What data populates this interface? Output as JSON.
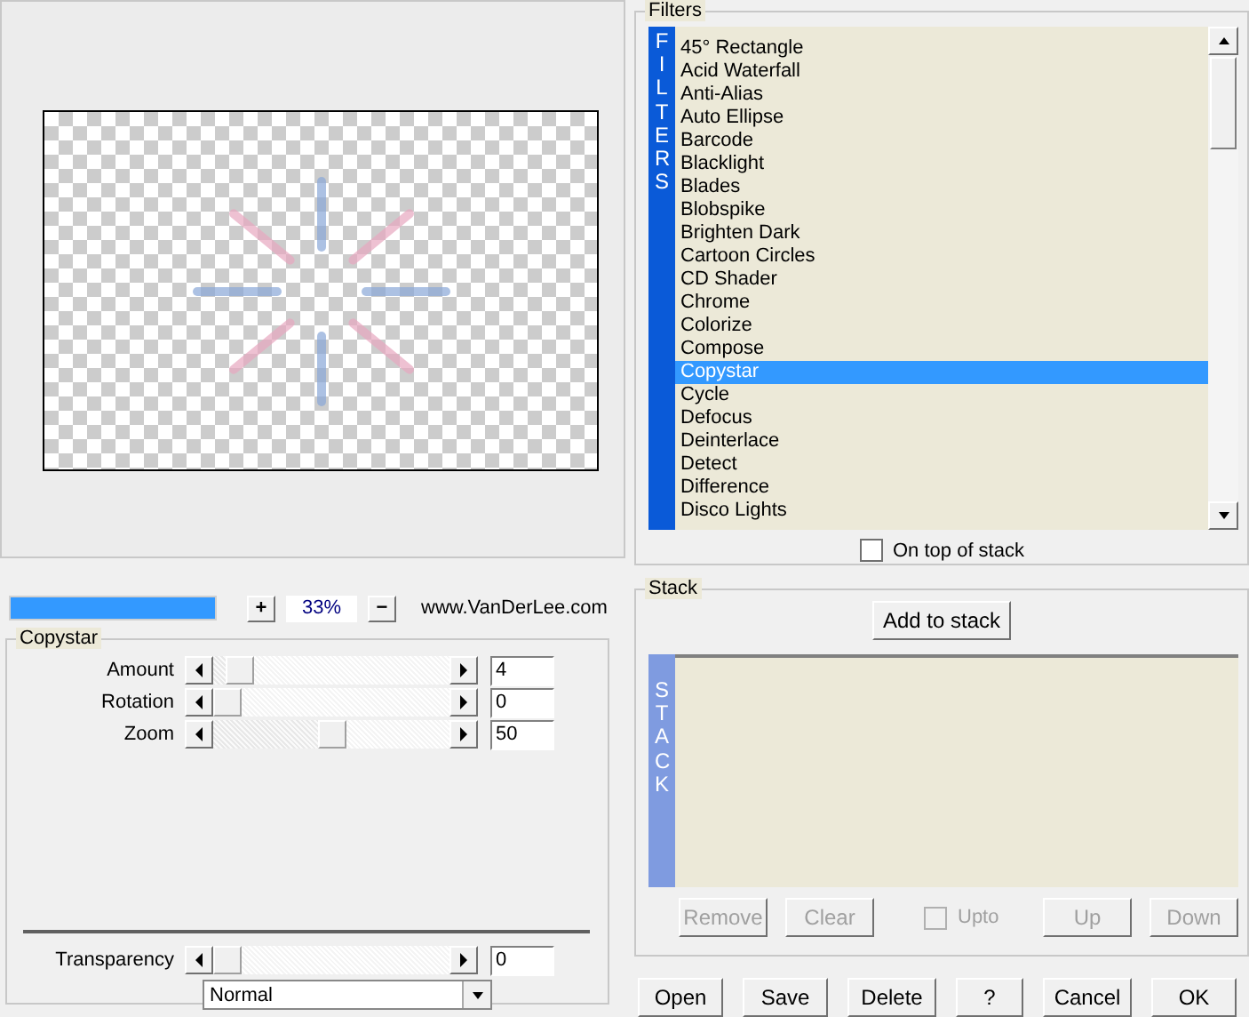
{
  "preview": {
    "zoom_progress": {
      "level": 1
    },
    "zoom_value": "33%",
    "zoom_in": "+",
    "zoom_out": "−",
    "credit": "www.VanDerLee.com"
  },
  "settings": {
    "title": "Copystar",
    "sliders": [
      {
        "label": "Amount",
        "level": 0.06,
        "value": "4"
      },
      {
        "label": "Rotation",
        "level": 0,
        "value": "0"
      },
      {
        "label": "Zoom",
        "level": 0.5,
        "value": "50"
      }
    ],
    "transparency": {
      "label": "Transparency",
      "level": 0,
      "value": "0"
    },
    "blend_mode": "Normal"
  },
  "filters": {
    "title": "Filters",
    "side_label": "FILTERS",
    "items": [
      {
        "label": "45° Rectangle",
        "selected": false
      },
      {
        "label": "Acid Waterfall",
        "selected": false
      },
      {
        "label": "Anti-Alias",
        "selected": false
      },
      {
        "label": "Auto Ellipse",
        "selected": false
      },
      {
        "label": "Barcode",
        "selected": false
      },
      {
        "label": "Blacklight",
        "selected": false
      },
      {
        "label": "Blades",
        "selected": false
      },
      {
        "label": "Blobspike",
        "selected": false
      },
      {
        "label": "Brighten Dark",
        "selected": false
      },
      {
        "label": "Cartoon Circles",
        "selected": false
      },
      {
        "label": "CD Shader",
        "selected": false
      },
      {
        "label": "Chrome",
        "selected": false
      },
      {
        "label": "Colorize",
        "selected": false
      },
      {
        "label": "Compose",
        "selected": false
      },
      {
        "label": "Copystar",
        "selected": true
      },
      {
        "label": "Cycle",
        "selected": false
      },
      {
        "label": "Defocus",
        "selected": false
      },
      {
        "label": "Deinterlace",
        "selected": false
      },
      {
        "label": "Detect",
        "selected": false
      },
      {
        "label": "Difference",
        "selected": false
      },
      {
        "label": "Disco Lights",
        "selected": false
      }
    ],
    "on_top_of_stack": {
      "label": "On top of stack",
      "checked": false
    }
  },
  "stack": {
    "title": "Stack",
    "add_button": "Add to stack",
    "side_label": "STACK",
    "buttons": [
      {
        "label": "Remove",
        "disabled": true
      },
      {
        "label": "Clear",
        "disabled": true
      }
    ],
    "upto": {
      "label": "Upto",
      "checked": false,
      "disabled": true
    },
    "move_buttons": [
      {
        "label": "Up",
        "disabled": true
      },
      {
        "label": "Down",
        "disabled": true
      }
    ]
  },
  "buttons": [
    "Open",
    "Save",
    "Delete",
    "?",
    "Cancel",
    "OK"
  ]
}
